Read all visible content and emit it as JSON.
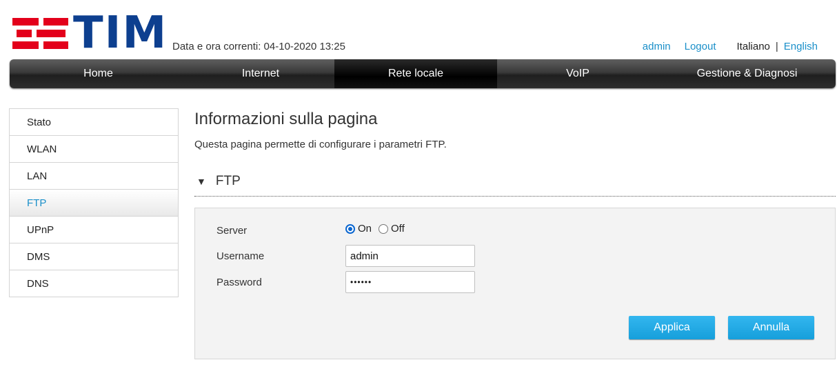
{
  "brand": {
    "name": "TIM",
    "colors": {
      "red": "#e3001b",
      "blue": "#0d3f8f",
      "accent": "#1a8fc9"
    }
  },
  "header": {
    "datetime": "Data e ora correnti: 04-10-2020 13:25",
    "user": "admin",
    "logout": "Logout",
    "lang_current": "Italiano",
    "lang_sep": "|",
    "lang_other": "English"
  },
  "nav": {
    "items": [
      {
        "label": "Home"
      },
      {
        "label": "Internet"
      },
      {
        "label": "Rete locale"
      },
      {
        "label": "VoIP"
      },
      {
        "label": "Gestione & Diagnosi"
      }
    ],
    "active": "Rete locale"
  },
  "sidebar": {
    "items": [
      {
        "label": "Stato"
      },
      {
        "label": "WLAN"
      },
      {
        "label": "LAN"
      },
      {
        "label": "FTP"
      },
      {
        "label": "UPnP"
      },
      {
        "label": "DMS"
      },
      {
        "label": "DNS"
      }
    ],
    "active": "FTP"
  },
  "main": {
    "title": "Informazioni sulla pagina",
    "description": "Questa pagina permette di configurare i parametri FTP.",
    "section_title": "FTP",
    "section_icon": "triangle-down-icon",
    "form": {
      "server_label": "Server",
      "server_on_label": "On",
      "server_off_label": "Off",
      "server_value": "On",
      "username_label": "Username",
      "username_value": "admin",
      "password_label": "Password",
      "password_value": "••••••"
    },
    "buttons": {
      "apply": "Applica",
      "cancel": "Annulla"
    }
  }
}
